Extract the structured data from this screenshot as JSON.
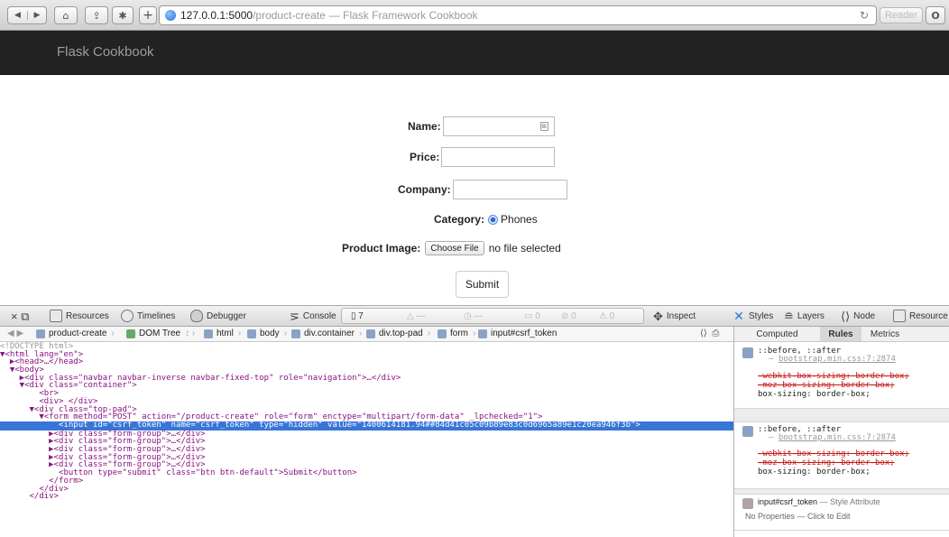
{
  "browser": {
    "url_host": "127.0.0.1:5000",
    "url_path": "/product-create",
    "page_title": "— Flask Framework Cookbook",
    "reader": "Reader",
    "reload_icon": "reload-icon"
  },
  "navbar": {
    "brand": "Flask Cookbook"
  },
  "form": {
    "name_label": "Name:",
    "price_label": "Price:",
    "company_label": "Company:",
    "category_label": "Category:",
    "category_value": "Phones",
    "image_label": "Product Image:",
    "choose_file": "Choose File",
    "no_file": "no file selected",
    "submit": "Submit"
  },
  "devtools": {
    "tabs": {
      "resources": "Resources",
      "timelines": "Timelines",
      "debugger": "Debugger",
      "console": "Console",
      "inspect": "Inspect",
      "styles": "Styles",
      "layers": "Layers",
      "node": "Node",
      "resource": "Resource"
    },
    "counters": [
      "7",
      "—",
      "—",
      "0",
      "0",
      "0"
    ],
    "breadcrumbs": [
      "product-create",
      "DOM Tree",
      "html",
      "body",
      "div.container",
      "div.top-pad",
      "form",
      "input#csrf_token"
    ],
    "dom": [
      "<!DOCTYPE html>",
      "▼<html lang=\"en\">",
      "  ▶<head>…</head>",
      "  ▼<body>",
      "    ▶<div class=\"navbar navbar-inverse navbar-fixed-top\" role=\"navigation\">…</div>",
      "    ▼<div class=\"container\">",
      "        <br>",
      "        <div> </div>",
      "      ▼<div class=\"top-pad\">",
      "        ▼<form method=\"POST\" action=\"/product-create\" role=\"form\" enctype=\"multipart/form-data\" _lpchecked=\"1\">",
      "            <input id=\"csrf_token\" name=\"csrf_token\" type=\"hidden\" value=\"1400614181.94##84d41c05c09b89e83c0d6965a89e1c20ea946f3b\">",
      "          ▶<div class=\"form-group\">…</div>",
      "          ▶<div class=\"form-group\">…</div>",
      "          ▶<div class=\"form-group\">…</div>",
      "          ▶<div class=\"form-group\">…</div>",
      "          ▶<div class=\"form-group\">…</div>",
      "            <button type=\"submit\" class=\"btn btn-default\">Submit</button>",
      "          </form>",
      "        </div>",
      "      </div>"
    ],
    "sidebar": {
      "tabs": [
        "Computed",
        "Rules",
        "Metrics"
      ],
      "rule1": {
        "selector": "::before, ::after",
        "source": "bootstrap.min.css:7:2874",
        "props": [
          "-webkit-box-sizing: border-box;",
          "-moz-box-sizing: border-box;",
          "box-sizing: border-box;"
        ]
      },
      "rule2": {
        "selector": "::before, ::after",
        "source": "bootstrap.min.css:7:2874",
        "props": [
          "-webkit-box-sizing: border-box;",
          "-moz-box-sizing: border-box;",
          "box-sizing: border-box;"
        ]
      },
      "style_attr": {
        "selector": "input#csrf_token",
        "suffix": "— Style Attribute",
        "empty": "No Properties — Click to Edit"
      }
    }
  }
}
